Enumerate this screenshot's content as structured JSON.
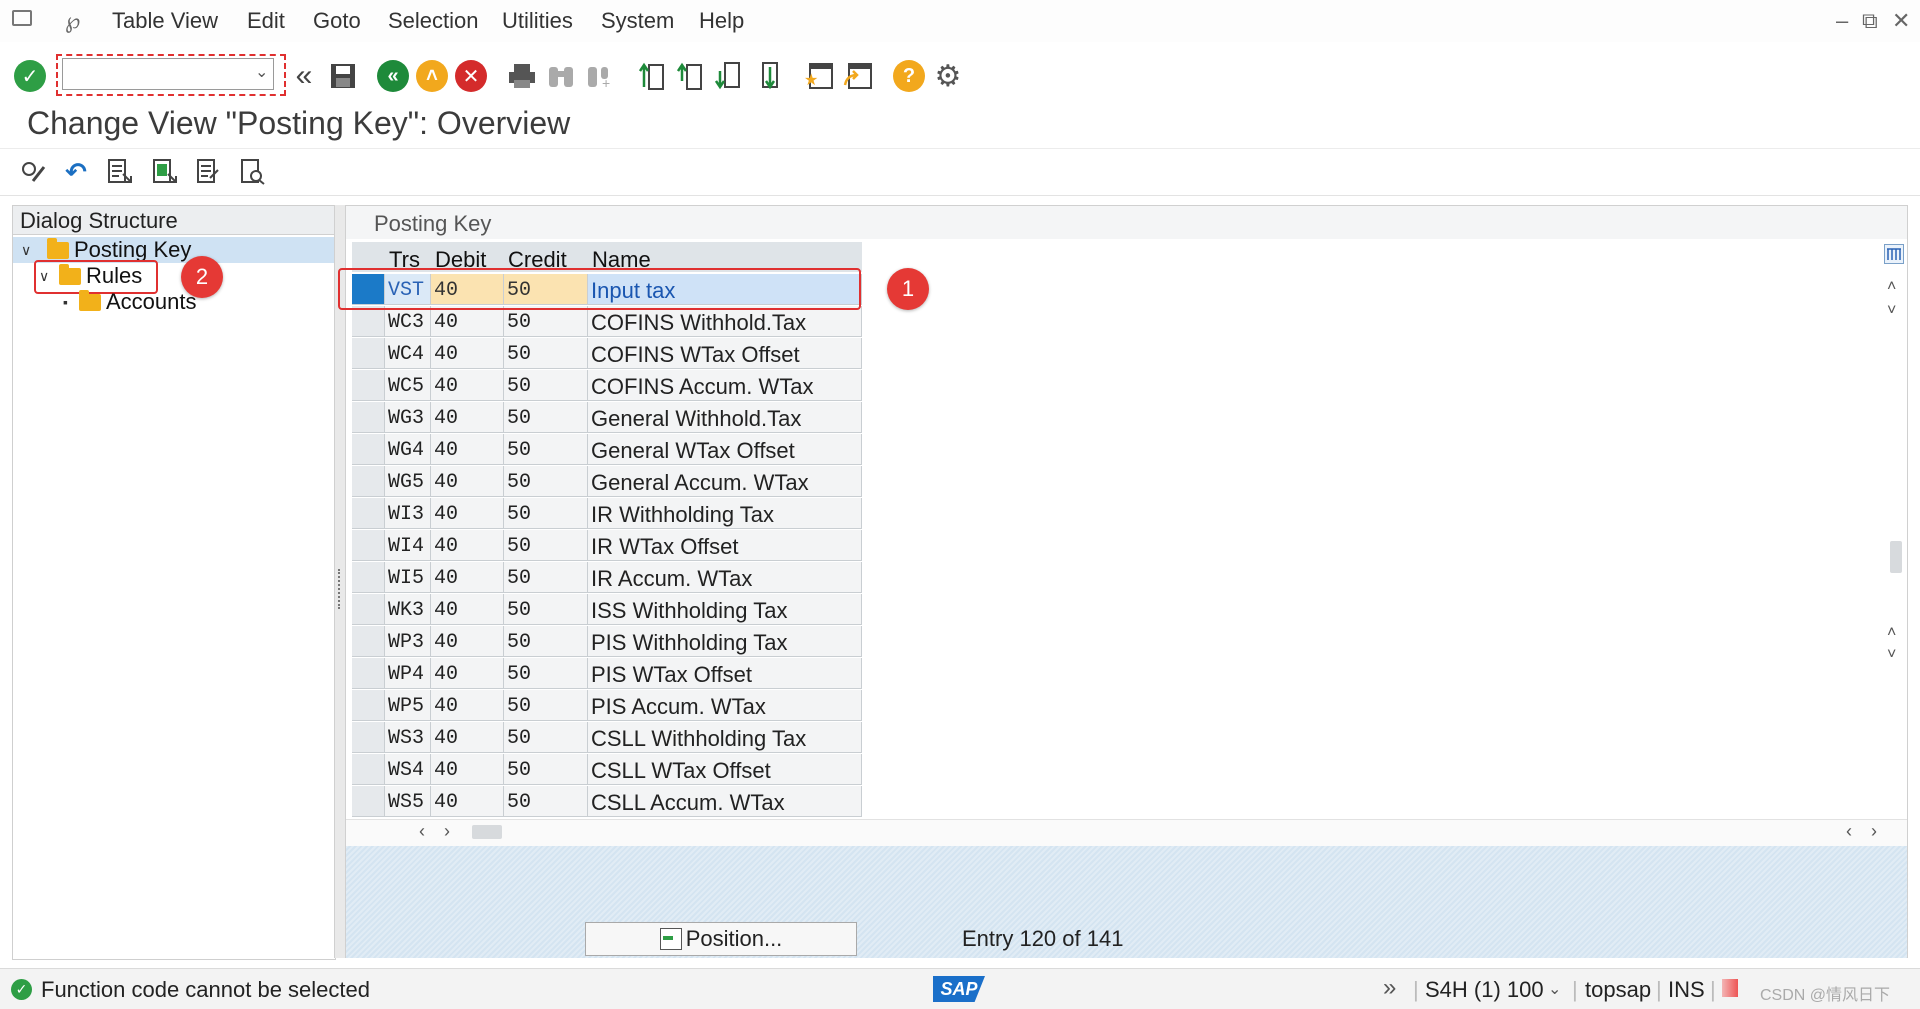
{
  "menubar": {
    "items": [
      "Table View",
      "Edit",
      "Goto",
      "Selection",
      "Utilities",
      "System",
      "Help"
    ],
    "icons": [
      "menu-icon",
      "customize-layout-icon"
    ],
    "window_controls": [
      "minimize-icon",
      "restore-icon",
      "close-icon"
    ]
  },
  "toolbar": {
    "command_field": {
      "value": "",
      "placeholder": ""
    },
    "icons": [
      "enter-icon",
      "back-icon",
      "save-icon",
      "exit-icon",
      "up-icon",
      "cancel-icon",
      "print-icon",
      "find-icon",
      "find-next-icon",
      "first-page-icon",
      "previous-page-icon",
      "next-page-icon",
      "last-page-icon",
      "new-session-icon",
      "shortcut-icon",
      "help-icon",
      "settings-icon"
    ]
  },
  "page_title": "Change View \"Posting Key\": Overview",
  "app_toolbar": {
    "icons": [
      "display-change-icon",
      "undo-icon",
      "select-all-icon",
      "select-block-icon",
      "deselect-all-icon",
      "selection-criteria-icon"
    ]
  },
  "dialog_structure": {
    "header": "Dialog Structure",
    "nodes": [
      {
        "label": "Posting Key",
        "level": 0,
        "expanded": true,
        "selected": true
      },
      {
        "label": "Rules",
        "level": 1,
        "expanded": true,
        "selected": false
      },
      {
        "label": "Accounts",
        "level": 2,
        "expanded": false,
        "selected": false
      }
    ]
  },
  "table": {
    "title": "Posting Key",
    "columns": [
      "Trs",
      "Debit",
      "Credit",
      "Name"
    ],
    "rows": [
      {
        "trs": "VST",
        "debit": "40",
        "credit": "50",
        "name": "Input tax"
      },
      {
        "trs": "WC3",
        "debit": "40",
        "credit": "50",
        "name": "COFINS Withhold.Tax"
      },
      {
        "trs": "WC4",
        "debit": "40",
        "credit": "50",
        "name": "COFINS WTax Offset"
      },
      {
        "trs": "WC5",
        "debit": "40",
        "credit": "50",
        "name": "COFINS Accum. WTax"
      },
      {
        "trs": "WG3",
        "debit": "40",
        "credit": "50",
        "name": "General Withhold.Tax"
      },
      {
        "trs": "WG4",
        "debit": "40",
        "credit": "50",
        "name": "General WTax Offset"
      },
      {
        "trs": "WG5",
        "debit": "40",
        "credit": "50",
        "name": "General Accum. WTax"
      },
      {
        "trs": "WI3",
        "debit": "40",
        "credit": "50",
        "name": "IR Withholding Tax"
      },
      {
        "trs": "WI4",
        "debit": "40",
        "credit": "50",
        "name": "IR WTax Offset"
      },
      {
        "trs": "WI5",
        "debit": "40",
        "credit": "50",
        "name": "IR Accum. WTax"
      },
      {
        "trs": "WK3",
        "debit": "40",
        "credit": "50",
        "name": "ISS Withholding Tax"
      },
      {
        "trs": "WP3",
        "debit": "40",
        "credit": "50",
        "name": "PIS Withholding Tax"
      },
      {
        "trs": "WP4",
        "debit": "40",
        "credit": "50",
        "name": "PIS WTax Offset"
      },
      {
        "trs": "WP5",
        "debit": "40",
        "credit": "50",
        "name": "PIS Accum. WTax"
      },
      {
        "trs": "WS3",
        "debit": "40",
        "credit": "50",
        "name": "CSLL Withholding Tax"
      },
      {
        "trs": "WS4",
        "debit": "40",
        "credit": "50",
        "name": "CSLL WTax Offset"
      },
      {
        "trs": "WS5",
        "debit": "40",
        "credit": "50",
        "name": "CSLL Accum. WTax"
      }
    ],
    "selected_row": 0
  },
  "annotations": {
    "badge1": "1",
    "badge2": "2"
  },
  "position_button": "Position...",
  "entry_text": "Entry 120 of 141",
  "statusbar": {
    "message": "Function code cannot be selected",
    "brand": "SAP",
    "system": "S4H (1) 100",
    "server": "topsap",
    "mode": "INS",
    "watermark": "CSDN @情风日下"
  },
  "colors": {
    "accent": "#1b7ac8",
    "annotation_red": "#e53935",
    "folder": "#f2b11a",
    "success": "#2e9e45"
  }
}
